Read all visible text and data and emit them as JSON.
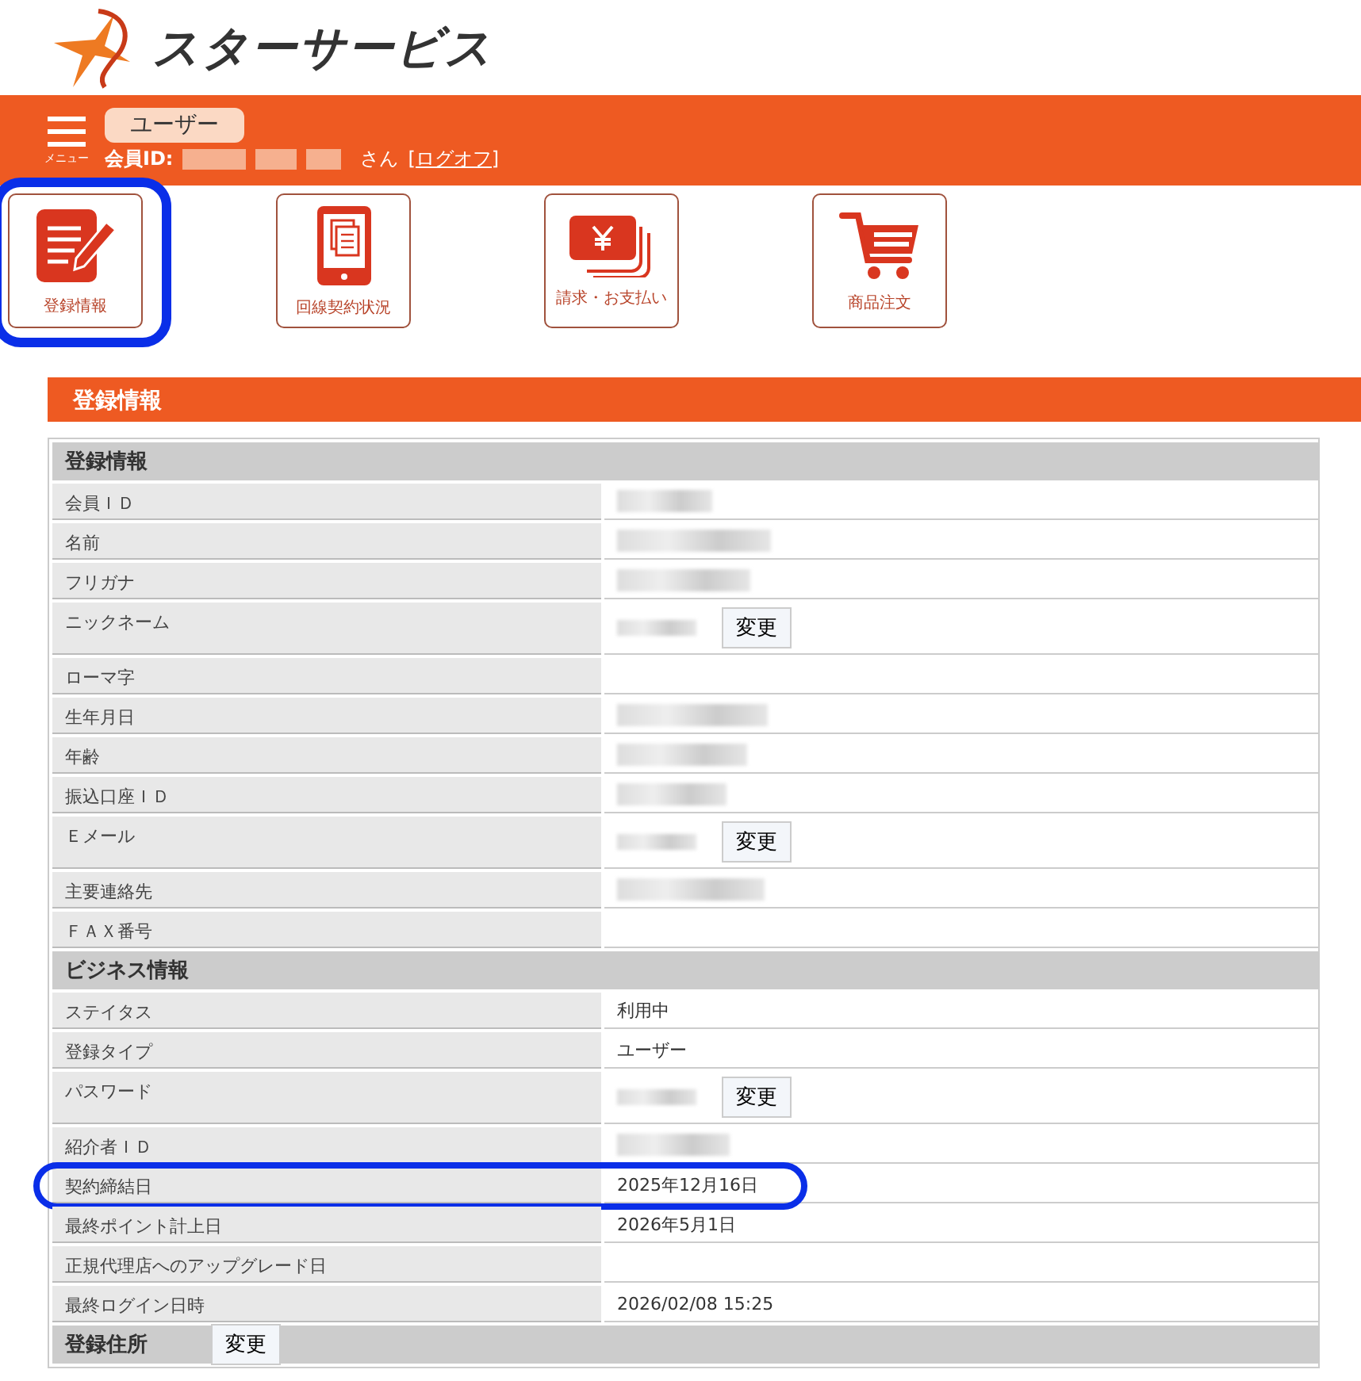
{
  "logo": {
    "text": "スターサービス"
  },
  "header": {
    "menu_label": "メニュー",
    "role_badge": "ユーザー",
    "member_label": "会員ID:",
    "member_id_redacted": true,
    "honorific": "さん",
    "logoff_link": "[ログオフ]"
  },
  "nav": [
    {
      "label": "登録情報",
      "highlighted": true
    },
    {
      "label": "回線契約状況",
      "highlighted": false
    },
    {
      "label": "請求・お支払い",
      "highlighted": false
    },
    {
      "label": "商品注文",
      "highlighted": false
    }
  ],
  "section_title": "登録情報",
  "groups": [
    {
      "title": "登録情報",
      "rows": [
        {
          "label": "会員ＩＤ",
          "redacted": true,
          "highlighted": false
        },
        {
          "label": "名前",
          "redacted": true,
          "highlighted": false
        },
        {
          "label": "フリガナ",
          "redacted": true,
          "highlighted": false
        },
        {
          "label": "ニックネーム",
          "redacted": true,
          "button": "変更",
          "highlighted": false
        },
        {
          "label": "ローマ字",
          "redacted": false,
          "highlighted": false
        },
        {
          "label": "生年月日",
          "redacted": true,
          "highlighted": false
        },
        {
          "label": "年齢",
          "redacted": true,
          "highlighted": false
        },
        {
          "label": "振込口座ＩＤ",
          "redacted": true,
          "highlighted": false
        },
        {
          "label": "Ｅメール",
          "redacted": true,
          "button": "変更",
          "highlighted": false
        },
        {
          "label": "主要連絡先",
          "redacted": true,
          "highlighted": false
        },
        {
          "label": "ＦＡＸ番号",
          "redacted": false,
          "highlighted": false
        }
      ]
    },
    {
      "title": "ビジネス情報",
      "rows": [
        {
          "label": "ステイタス",
          "value": "利用中",
          "redacted": false,
          "highlighted": false
        },
        {
          "label": "登録タイプ",
          "value": "ユーザー",
          "redacted": false,
          "highlighted": false
        },
        {
          "label": "パスワード",
          "redacted": true,
          "button": "変更",
          "highlighted": false
        },
        {
          "label": "紹介者ＩＤ",
          "redacted": true,
          "highlighted": false
        },
        {
          "label": "契約締結日",
          "value": "2025年12月16日",
          "redacted": false,
          "highlighted": true
        },
        {
          "label": "最終ポイント計上日",
          "value": "2026年5月1日",
          "redacted": false,
          "highlighted": false
        },
        {
          "label": "正規代理店へのアップグレード日",
          "redacted": false,
          "highlighted": false
        },
        {
          "label": "最終ログイン日時",
          "value": "2026/02/08 15:25",
          "redacted": false,
          "highlighted": false
        }
      ]
    },
    {
      "title": "登録住所",
      "button": "変更"
    }
  ]
}
